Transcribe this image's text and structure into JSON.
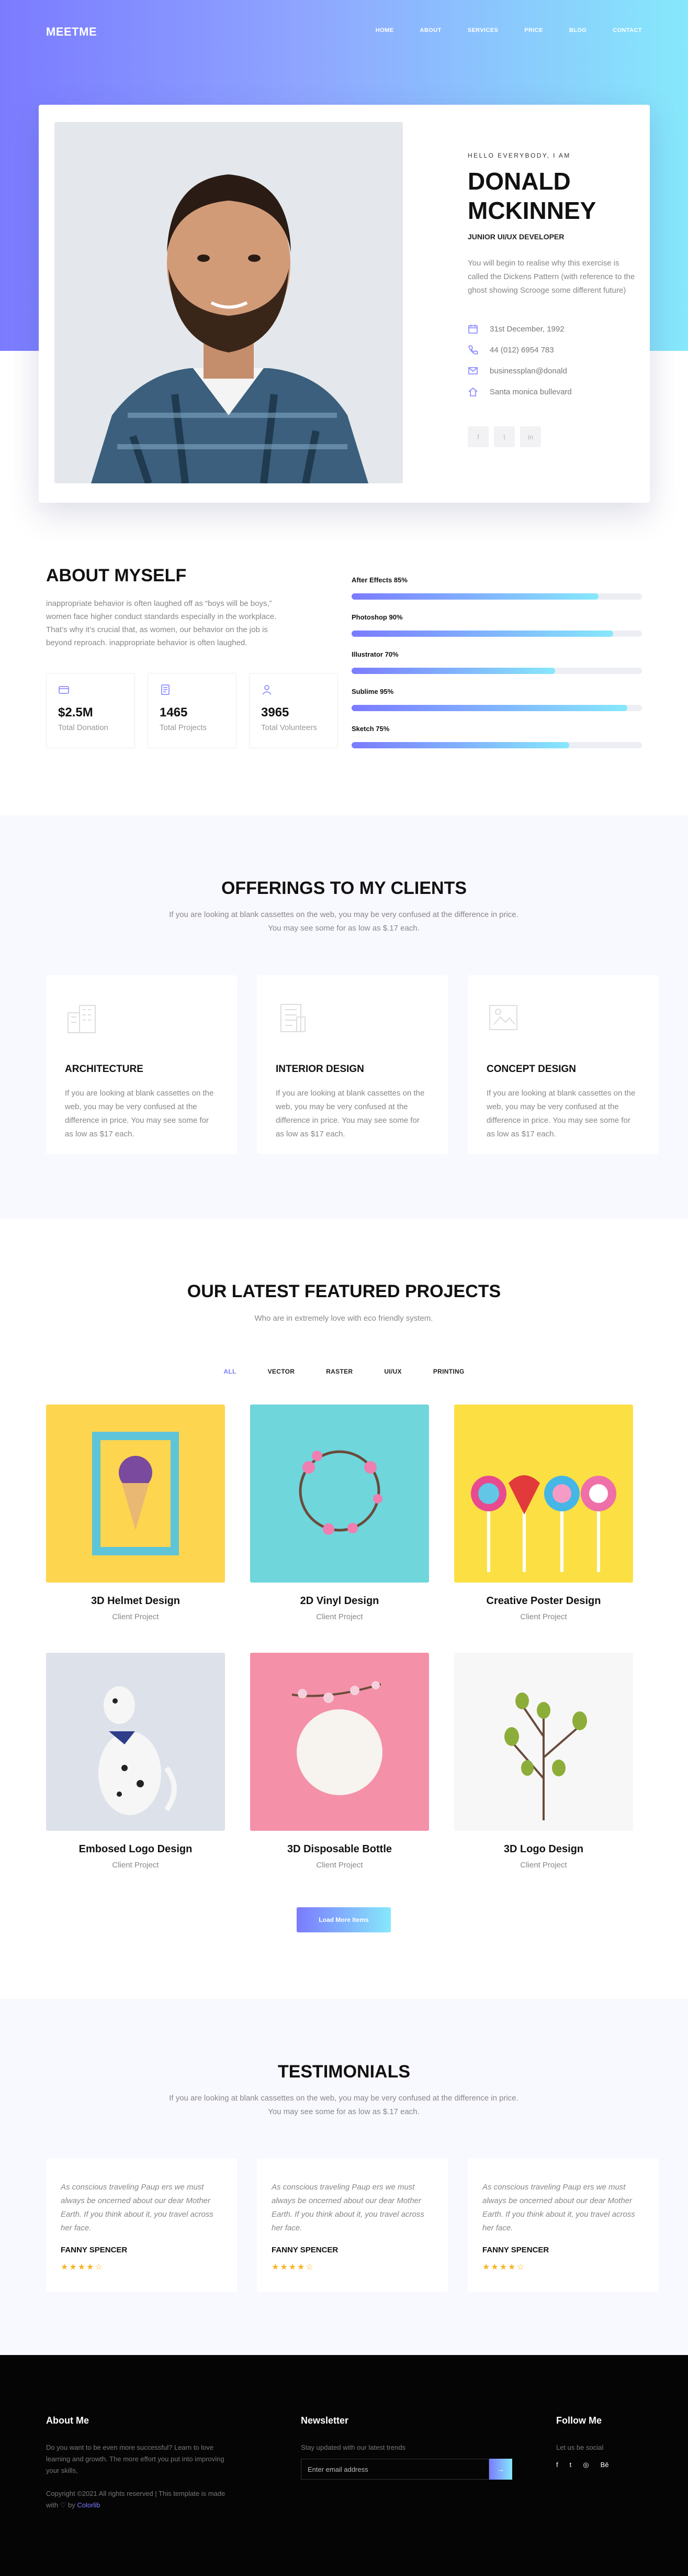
{
  "brand": {
    "logo": "MEETME"
  },
  "nav": [
    "HOME",
    "ABOUT",
    "SERVICES",
    "PRICE",
    "BLOG",
    "CONTACT"
  ],
  "hero": {
    "greeting": "HELLO EVERYBODY, I AM",
    "name_line1": "DONALD",
    "name_line2": "MCKINNEY",
    "role": "JUNIOR UI/UX DEVELOPER",
    "intro": "You will begin to realise why this exercise is called the Dickens Pattern (with reference to the ghost showing Scrooge some different future)",
    "contacts": {
      "birthday": "31st December, 1992",
      "phone": "44 (012) 6954 783",
      "email": "businessplan@donald",
      "address": "Santa monica bullevard"
    },
    "socials": [
      "f",
      "t",
      "in"
    ]
  },
  "about": {
    "title": "ABOUT MYSELF",
    "description": "inappropriate behavior is often laughed off as “boys will be boys,” women face higher conduct standards especially in the workplace. That’s why it’s crucial that, as women, our behavior on the job is beyond reproach. inappropriate behavior is often laughed.",
    "stats": [
      {
        "value": "$2.5M",
        "label": "Total Donation"
      },
      {
        "value": "1465",
        "label": "Total Projects"
      },
      {
        "value": "3965",
        "label": "Total Volunteers"
      }
    ],
    "skills": [
      {
        "label": "After Effects 85%",
        "level": 0.85
      },
      {
        "label": "Photoshop 90%",
        "level": 0.9
      },
      {
        "label": "Illustrator 70%",
        "level": 0.7
      },
      {
        "label": "Sublime 95%",
        "level": 0.95
      },
      {
        "label": "Sketch 75%",
        "level": 0.75
      }
    ]
  },
  "offerings": {
    "title": "OFFERINGS TO MY CLIENTS",
    "subtitle": "If you are looking at blank cassettes on the web, you may be very confused at the difference in price. You may see some for as low as $.17 each.",
    "cards": [
      {
        "icon": "building-icon",
        "title": "ARCHITECTURE",
        "text": "If you are looking at blank cassettes on the web, you may be very confused at the difference in price. You may see some for as low as $17 each."
      },
      {
        "icon": "interior-icon",
        "title": "INTERIOR DESIGN",
        "text": "If you are looking at blank cassettes on the web, you may be very confused at the difference in price. You may see some for as low as $17 each."
      },
      {
        "icon": "concept-icon",
        "title": "CONCEPT DESIGN",
        "text": "If you are looking at blank cassettes on the web, you may be very confused at the difference in price. You may see some for as low as $17 each."
      }
    ]
  },
  "projects": {
    "title": "OUR LATEST FEATURED PROJECTS",
    "subtitle": "Who are in extremely love with eco friendly system.",
    "filters": [
      "ALL",
      "VECTOR",
      "RASTER",
      "UI/UX",
      "PRINTING"
    ],
    "active_filter": "ALL",
    "items": [
      {
        "title": "3D Helmet Design",
        "subtitle": "Client Project"
      },
      {
        "title": "2D Vinyl Design",
        "subtitle": "Client Project"
      },
      {
        "title": "Creative Poster Design",
        "subtitle": "Client Project"
      },
      {
        "title": "Embosed Logo Design",
        "subtitle": "Client Project"
      },
      {
        "title": "3D Disposable Bottle",
        "subtitle": "Client Project"
      },
      {
        "title": "3D Logo Design",
        "subtitle": "Client Project"
      }
    ],
    "load_more": "Load More Items"
  },
  "testimonials": {
    "title": "TESTIMONIALS",
    "subtitle": "If you are looking at blank cassettes on the web, you may be very confused at the difference in price. You may see some for as low as $.17 each.",
    "items": [
      {
        "quote": "As conscious traveling Paup ers we must always be oncerned about our dear Mother Earth. If you think about it, you travel across her face.",
        "name": "FANNY SPENCER",
        "stars": "★★★★☆"
      },
      {
        "quote": "As conscious traveling Paup ers we must always be oncerned about our dear Mother Earth. If you think about it, you travel across her face.",
        "name": "FANNY SPENCER",
        "stars": "★★★★☆"
      },
      {
        "quote": "As conscious traveling Paup ers we must always be oncerned about our dear Mother Earth. If you think about it, you travel across her face.",
        "name": "FANNY SPENCER",
        "stars": "★★★★☆"
      }
    ]
  },
  "footer": {
    "about_title": "About Me",
    "about_text": "Do you want to be even more successful? Learn to love learning and growth. The more effort you put into improving your skills,",
    "copyright": "Copyright ©2021 All rights reserved | This template is made with ♡ by",
    "copyright_link": "Colorlib",
    "newsletter_title": "Newsletter",
    "newsletter_text": "Stay updated with our latest trends",
    "newsletter_placeholder": "Enter email address",
    "follow_title": "Follow Me",
    "follow_text": "Let us be social",
    "follow_icons": [
      "f",
      "t",
      "◎",
      "Bē"
    ]
  },
  "colors": {
    "accent_start": "#7b7bff",
    "accent_end": "#86e8fb",
    "star": "#f7b422"
  }
}
